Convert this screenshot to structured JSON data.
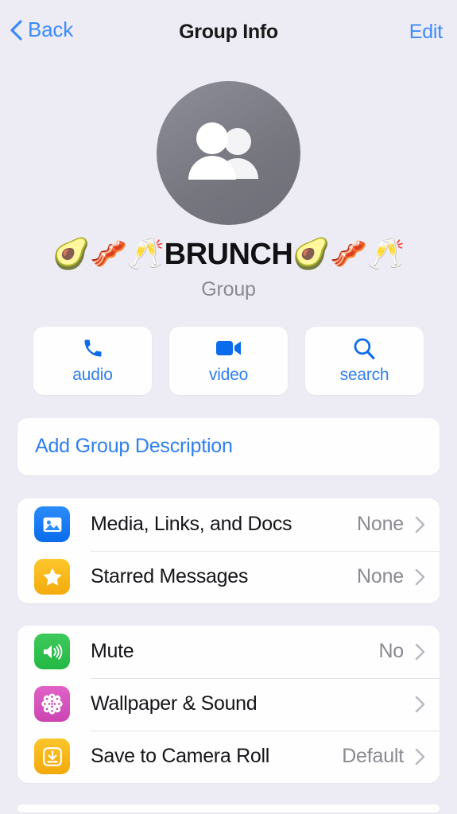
{
  "header": {
    "back_label": "Back",
    "back_icon": "chevron-left-icon",
    "title": "Group Info",
    "edit_label": "Edit"
  },
  "profile": {
    "avatar_icon": "group-people-icon",
    "avatar_color": "#76767f",
    "name": "🥑🥓🥂BRUNCH🥑🥓🥂",
    "subtitle": "Group"
  },
  "actions": [
    {
      "label": "audio",
      "icon": "phone-icon"
    },
    {
      "label": "video",
      "icon": "video-camera-icon"
    },
    {
      "label": "search",
      "icon": "search-icon"
    }
  ],
  "description": {
    "label": "Add Group Description"
  },
  "media_section": [
    {
      "label": "Media, Links, and Docs",
      "value": "None",
      "icon": "photo-icon",
      "icon_color": "#0a6bec"
    },
    {
      "label": "Starred Messages",
      "value": "None",
      "icon": "star-icon",
      "icon_color": "#f4ab0d"
    }
  ],
  "settings_section": [
    {
      "label": "Mute",
      "value": "No",
      "icon": "speaker-icon",
      "icon_color": "#23b844"
    },
    {
      "label": "Wallpaper & Sound",
      "value": "",
      "icon": "flower-icon",
      "icon_color": "#cc45b2"
    },
    {
      "label": "Save to Camera Roll",
      "value": "Default",
      "icon": "download-icon",
      "icon_color": "#f2a90c"
    }
  ],
  "theme": {
    "accent": "#2f7ff0",
    "background": "#edecf4",
    "card": "#fefefe",
    "secondary_text": "#8a8a92"
  }
}
